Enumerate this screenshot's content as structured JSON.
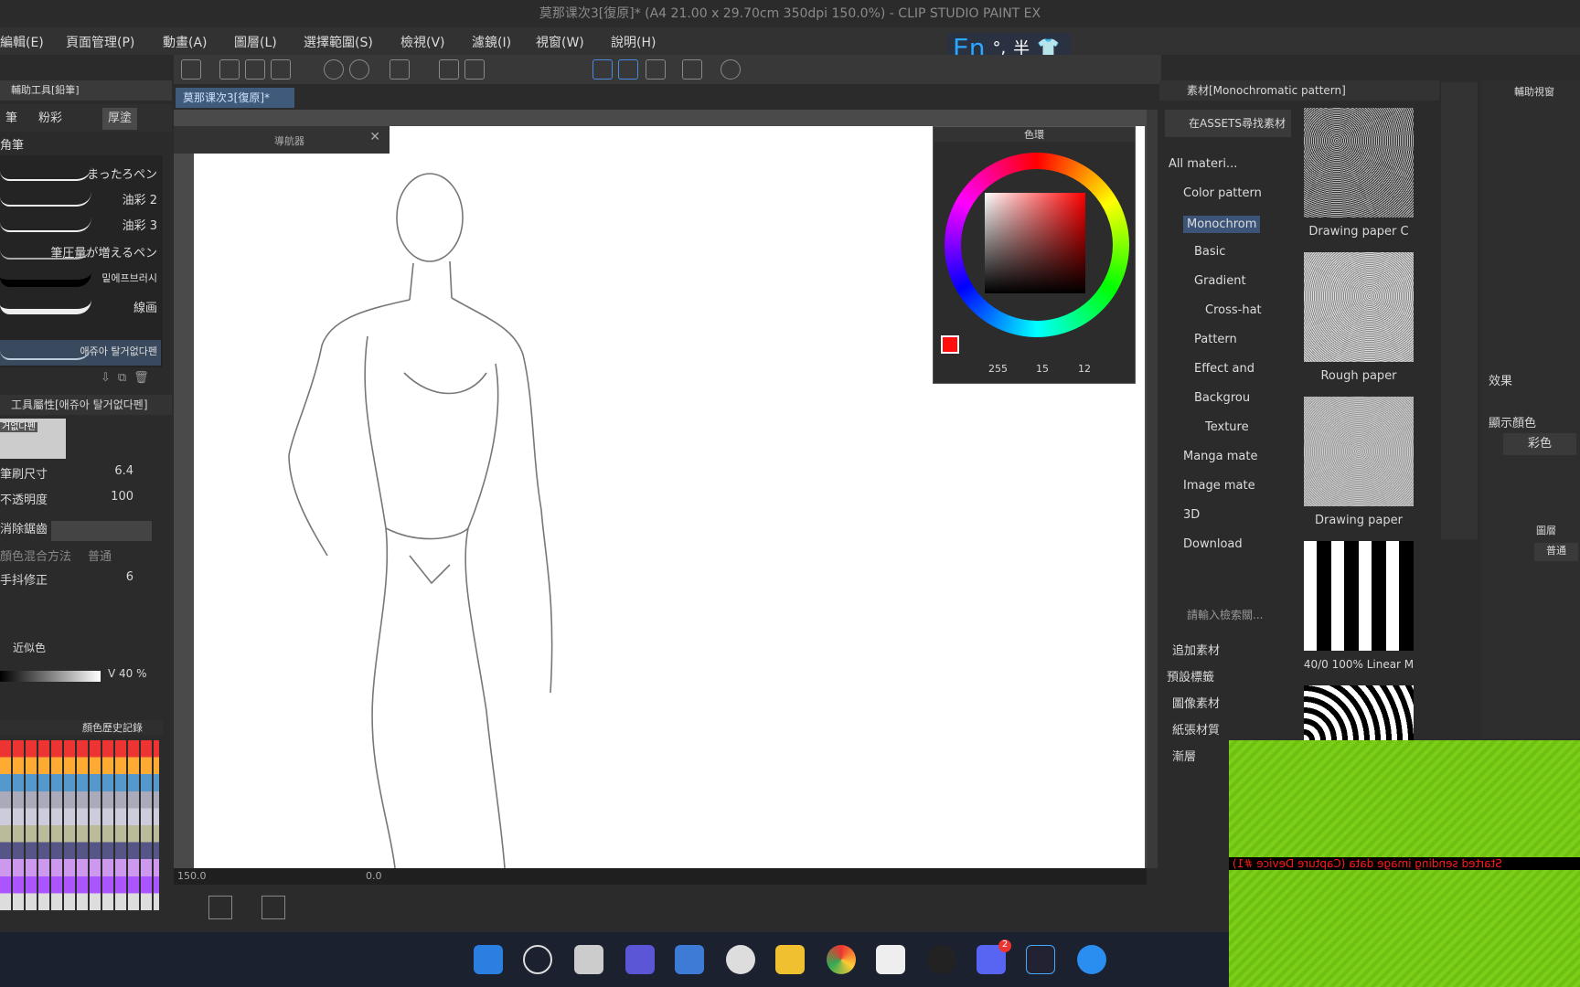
{
  "window": {
    "title": "莫那课次3[復原]* (A4 21.00 x 29.70cm 350dpi 150.0%) - CLIP STUDIO PAINT EX"
  },
  "menu": [
    {
      "label": "編輯(E)"
    },
    {
      "label": "頁面管理(P)"
    },
    {
      "label": "動畫(A)"
    },
    {
      "label": "圖層(L)"
    },
    {
      "label": "選擇範圍(S)"
    },
    {
      "label": "檢視(V)"
    },
    {
      "label": "濾鏡(I)"
    },
    {
      "label": "視窗(W)"
    },
    {
      "label": "說明(H)"
    }
  ],
  "ime": {
    "lang": "En",
    "punct": "°,",
    "width": "半"
  },
  "doc_tab": {
    "label": "莫那课次3[復原]*"
  },
  "left_panel": {
    "header": "輔助工具[鉛筆]",
    "tabs": [
      "筆",
      "粉彩",
      "厚塗"
    ],
    "subheader": "角筆",
    "brushes": [
      {
        "label": "まったろペン"
      },
      {
        "label": "油彩 2"
      },
      {
        "label": "油彩 3"
      },
      {
        "label": "筆圧量が増えるペン"
      },
      {
        "label": "밑에프브러시"
      },
      {
        "label": "線画"
      },
      {
        "label": "애쥬아 탈거없다펜"
      }
    ],
    "tool_prop_header": "工具屬性[애쥬아 탈거없다펜]",
    "tool_preview_label": "거없다펜",
    "props": [
      {
        "label": "筆刷尺寸",
        "value": "6.4"
      },
      {
        "label": "不透明度",
        "value": "100"
      },
      {
        "label": "消除鋸齒",
        "value": ""
      },
      {
        "label": "顏色混合方法",
        "value": "普通"
      },
      {
        "label": "手抖修正",
        "value": "6"
      }
    ],
    "color_tabs": [
      "近似色"
    ],
    "v_value": "V 40 %",
    "history_tab": "顏色歷史記錄"
  },
  "nav_panel": {
    "label": "導航器"
  },
  "color_panel": {
    "title": "色環",
    "r": "255",
    "g": "15",
    "b": "12"
  },
  "status": {
    "zoom": "150.0",
    "angle": "0.0"
  },
  "materials": {
    "header": "素材[Monochromatic pattern]",
    "search_assets": "在ASSETS尋找素材",
    "tree": [
      {
        "label": "All materi..."
      },
      {
        "label": "Color pattern"
      },
      {
        "label": "Monochrom"
      },
      {
        "label": "Basic"
      },
      {
        "label": "Gradient"
      },
      {
        "label": "Cross-hat"
      },
      {
        "label": "Pattern"
      },
      {
        "label": "Effect and"
      },
      {
        "label": "Backgrou"
      },
      {
        "label": "Texture"
      },
      {
        "label": "Manga mate"
      },
      {
        "label": "Image mate"
      },
      {
        "label": "3D"
      },
      {
        "label": "Download"
      }
    ],
    "search_placeholder": "請輸入檢索關...",
    "tags": [
      "追加素材",
      "預設標籤",
      "圖像素材",
      "紙張材質",
      "漸層"
    ],
    "thumbs": [
      {
        "caption": "Drawing paper C"
      },
      {
        "caption": "Rough paper"
      },
      {
        "caption": "Drawing paper"
      },
      {
        "caption": "40/0 100% Linear M"
      }
    ]
  },
  "right_panel": {
    "header": "輔助視窗",
    "effect_label": "效果",
    "display_color_label": "顯示顏色",
    "color_mode": "彩色",
    "layer_header": "圖層",
    "blend": "普通"
  },
  "overlay": {
    "text": "Started sending image data (Capture Device #1)"
  },
  "taskbar": {
    "badge": "2"
  },
  "colors": {
    "accent_red": "#ff1a1a",
    "ime_blue": "#2aa7ff",
    "green_overlay": "#7ccf18"
  }
}
